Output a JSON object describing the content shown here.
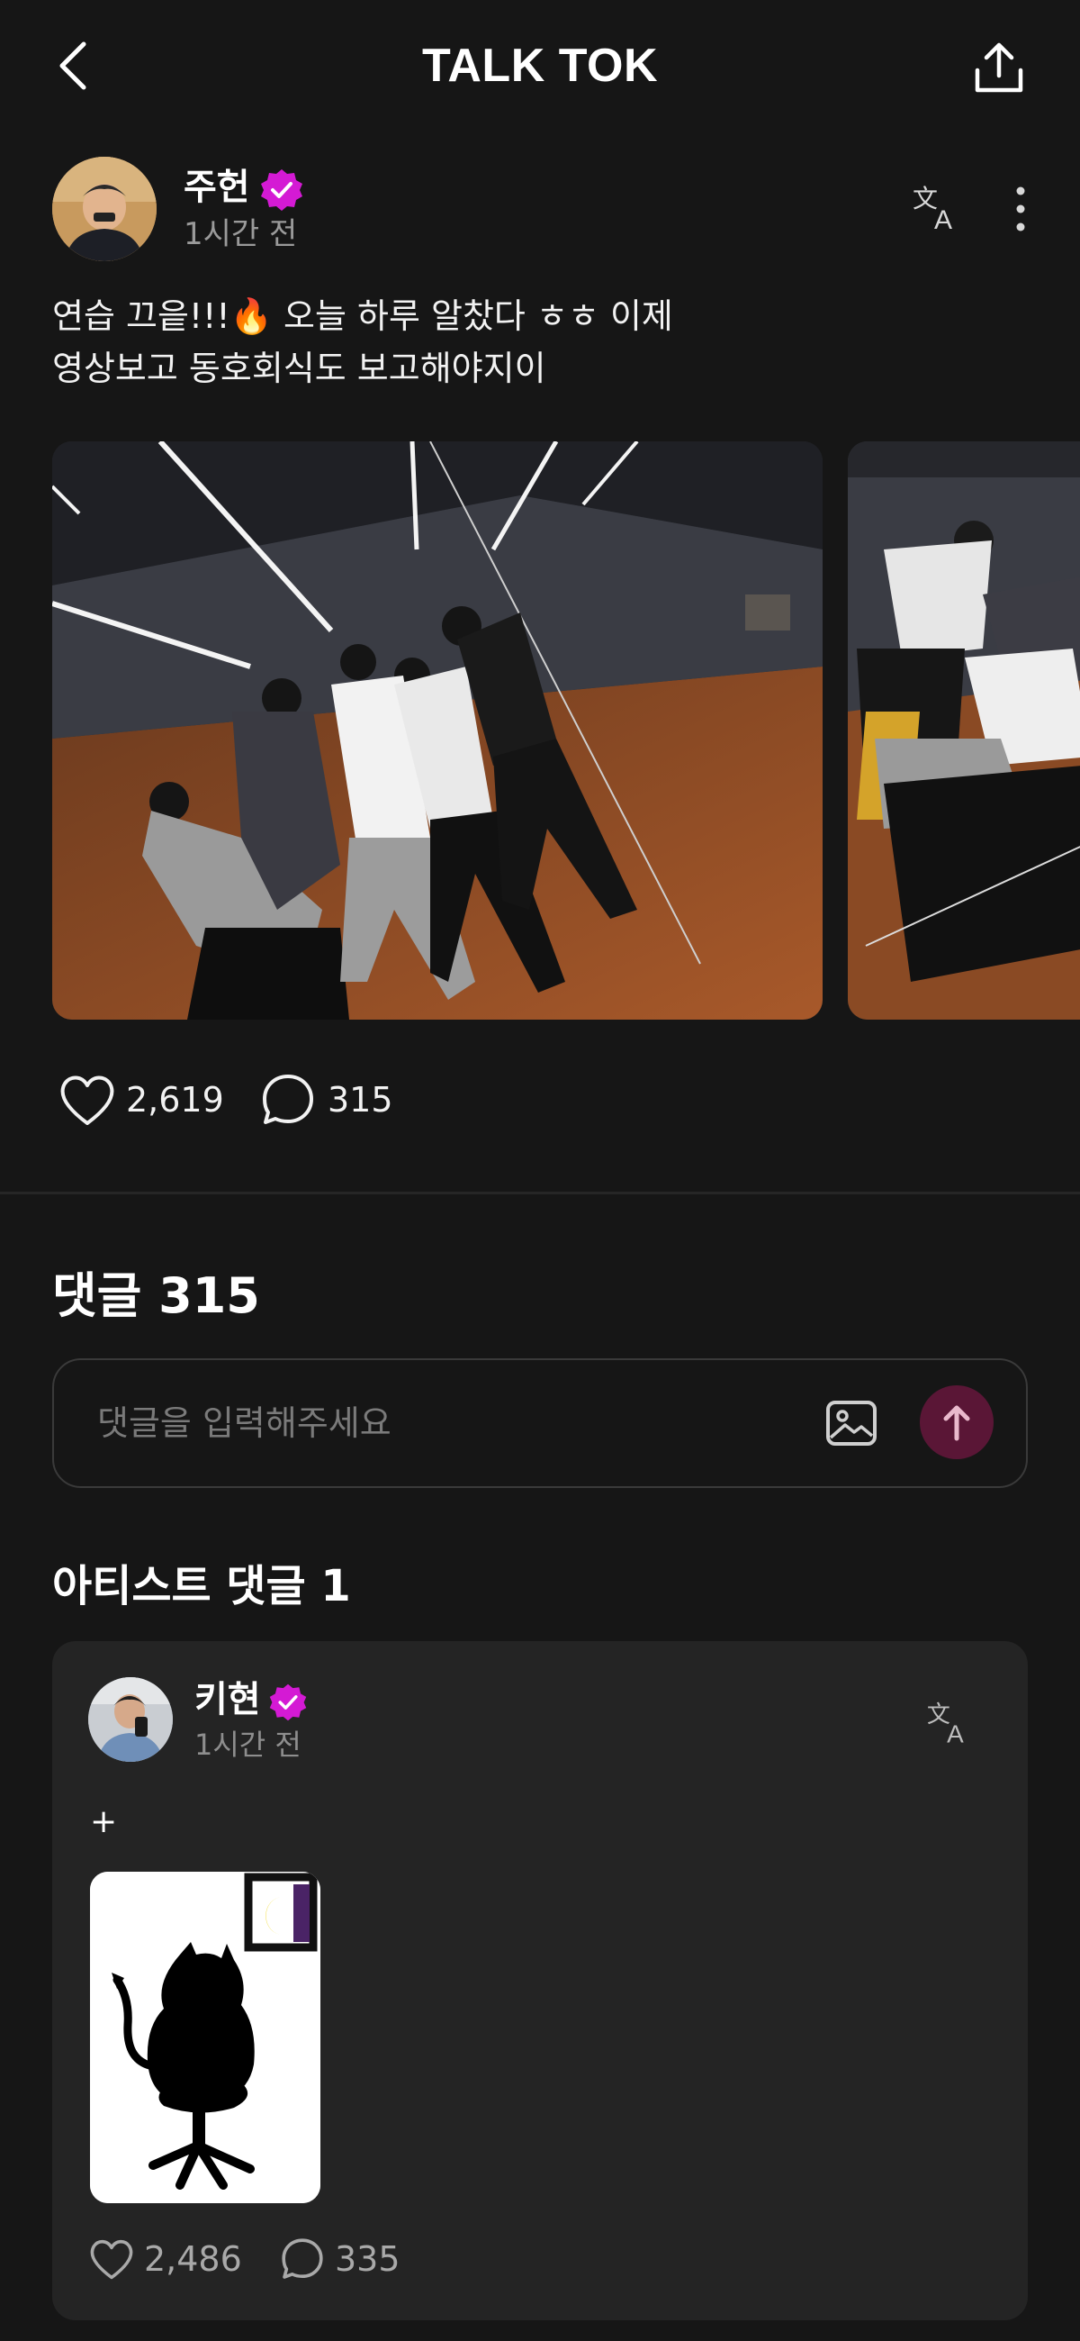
{
  "header": {
    "title": "TALK TOK",
    "back_icon": "chevron-left-icon",
    "share_icon": "share-upload-icon"
  },
  "post": {
    "author": "주헌",
    "time": "1시간 전",
    "text_line1": "연습 끄읕!!!🔥 오늘 하루 알찼다 ㅎㅎ 이제",
    "text_line2": "영상보고 동호회식도 보고해야지이",
    "likes": "2,619",
    "comments": "315"
  },
  "comments_section": {
    "heading": "댓글 315",
    "input_placeholder": "댓글을 입력해주세요"
  },
  "artist_comments": {
    "heading": "아티스트 댓글 1",
    "items": [
      {
        "author": "키현",
        "time": "1시간 전",
        "text": "+",
        "likes": "2,486",
        "comments": "335"
      }
    ]
  },
  "colors": {
    "background": "#161616",
    "card": "#242424",
    "verified": "#d41ad4",
    "send_button": "#5a1636"
  }
}
